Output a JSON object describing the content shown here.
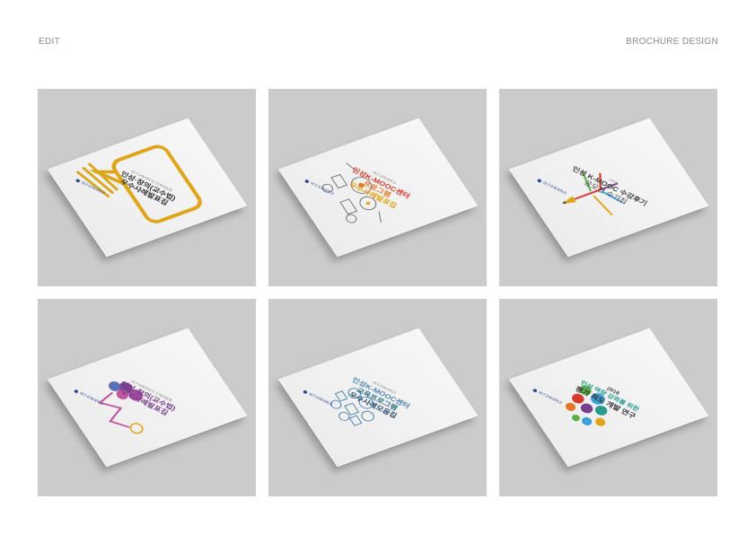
{
  "header": {
    "left_label": "EDIT",
    "right_label": "BROCHURE DESIGN"
  },
  "brochures": [
    {
      "kicker": "대구교육대학교 인재개발원",
      "title_line1": "인성·창의(교수법)",
      "title_line2": "우수사례발표집",
      "logo_text": "대구교육대학교",
      "accent": "#e0a418"
    },
    {
      "kicker": "대구교육대학교",
      "title_line1": "인성K-MOOC센터",
      "title_line2": "프로그램",
      "title_line3": "우수사례발표집",
      "logo_text": "대구교육대학교",
      "accent": "#e07a26"
    },
    {
      "kicker": "2018",
      "title_line1": "인성 K-MOOC 수강후기",
      "title_line2": "공모전 수기집",
      "logo_text": "대구교육대학교",
      "accent": "#d63a2e"
    },
    {
      "kicker": "대구교육대학교 인재개발원",
      "title_line1": "인성·창의(교수법)",
      "title_line2": "우수사례발표집",
      "logo_text": "대구교육대학교",
      "accent": "#7b3f8f"
    },
    {
      "kicker": "대구교육대학교",
      "title_line1": "인성K-MOOC센터",
      "title_line2": "교육프로그램",
      "title_line3": "우수사례모음집",
      "logo_text": "대구교육대학교",
      "accent": "#4f87b0"
    },
    {
      "kicker": "2018",
      "title_line1": "인성 역량 강화를 위한",
      "title_line2": "평가 척도 개발 연구",
      "logo_text": "대구교육대학교",
      "accent": "#2a9c8e"
    }
  ]
}
